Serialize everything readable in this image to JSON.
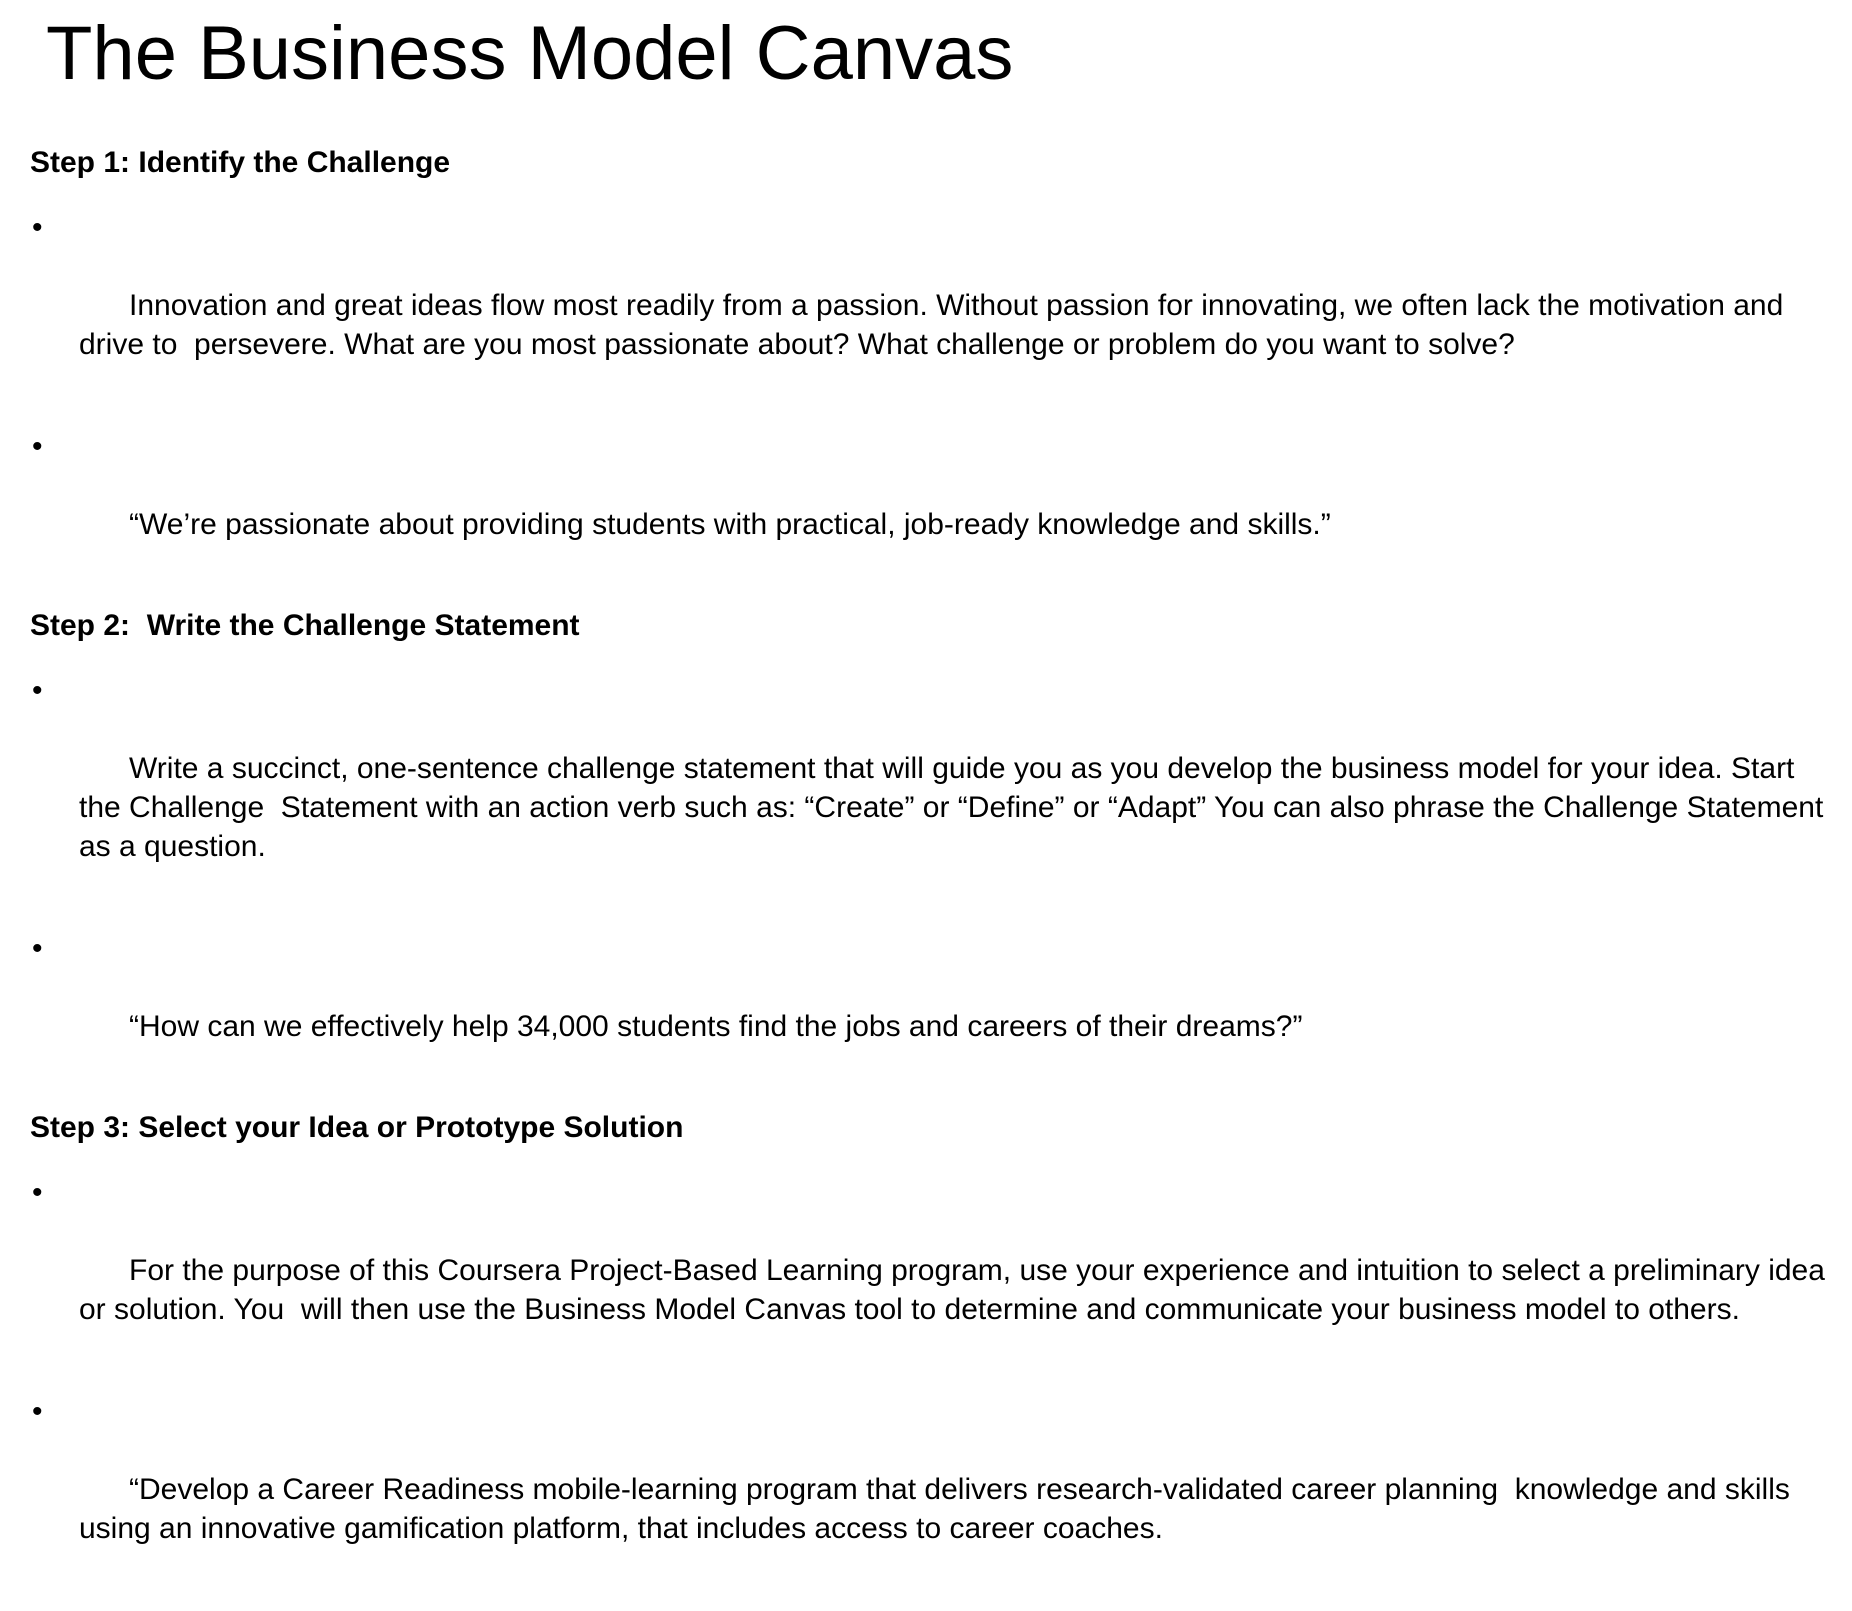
{
  "title": "The Business Model Canvas",
  "steps": [
    {
      "heading": "Step 1: Identify the Challenge",
      "bullets": [
        "Innovation and great ideas flow most readily from a passion. Without passion for innovating, we often lack the motivation and drive to  persevere. What are you most passionate about? What challenge or problem do you want to solve?",
        "“We’re passionate about providing students with practical, job-ready knowledge and skills.”"
      ]
    },
    {
      "heading": "Step 2:  Write the Challenge Statement",
      "bullets": [
        "Write a succinct, one-sentence challenge statement that will guide you as you develop the business model for your idea. Start the Challenge  Statement with an action verb such as: “Create” or “Define” or “Adapt” You can also phrase the Challenge Statement as a question.",
        "“How can we effectively help 34,000 students find the jobs and careers of their dreams?”"
      ]
    },
    {
      "heading": "Step 3: Select your Idea or Prototype Solution",
      "bullets": [
        "For the purpose of this Coursera Project-Based Learning program, use your experience and intuition to select a preliminary idea or solution. You  will then use the Business Model Canvas tool to determine and communicate your business model to others.",
        "“Develop a Career Readiness mobile-learning program that delivers research-validated career planning  knowledge and skills using an innovative gamification platform, that includes access to career coaches."
      ]
    }
  ],
  "bullet_symbol": "•"
}
